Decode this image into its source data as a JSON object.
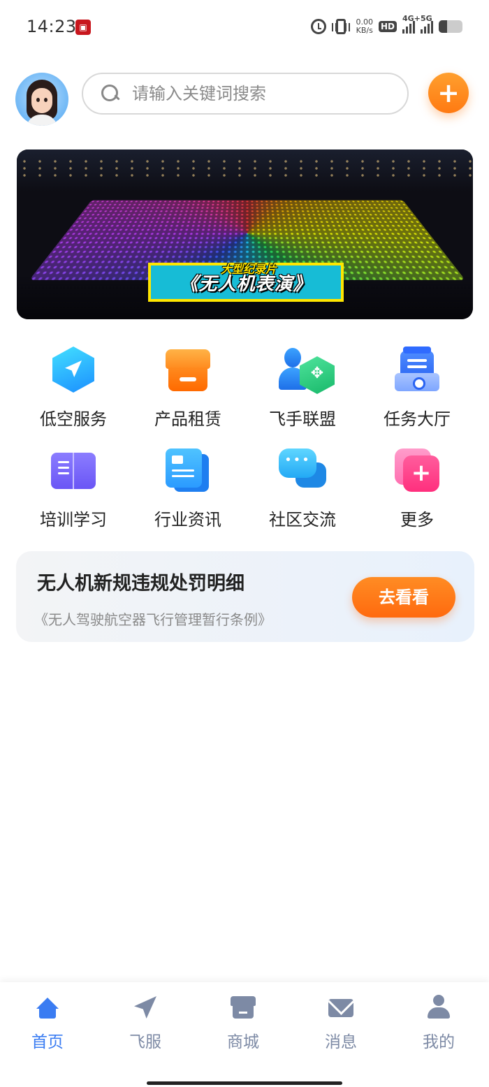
{
  "status_bar": {
    "time": "14:23",
    "netspeed_value": "0.00",
    "netspeed_unit": "KB/s",
    "hd_label": "HD",
    "signal1_label": "4G+",
    "signal2_label": "5G",
    "battery_level_percent": 35
  },
  "header": {
    "search_placeholder": "请输入关键词搜索",
    "add_label": "+"
  },
  "banner": {
    "caption_top": "大型纪录片",
    "caption_main": "《无人机表演》"
  },
  "grid": {
    "items": [
      {
        "label": "低空服务",
        "icon": "paper-plane-hex-icon"
      },
      {
        "label": "产品租赁",
        "icon": "shop-icon"
      },
      {
        "label": "飞手联盟",
        "icon": "pilot-drone-icon"
      },
      {
        "label": "任务大厅",
        "icon": "clipboard-icon"
      },
      {
        "label": "培训学习",
        "icon": "book-icon"
      },
      {
        "label": "行业资讯",
        "icon": "news-doc-icon"
      },
      {
        "label": "社区交流",
        "icon": "chat-bubbles-icon"
      },
      {
        "label": "更多",
        "icon": "plus-squares-icon"
      }
    ]
  },
  "notice": {
    "title": "无人机新规违规处罚明细",
    "subtitle": "《无人驾驶航空器飞行管理暂行条例》",
    "button_label": "去看看"
  },
  "tab_bar": {
    "active": "首页",
    "tabs": [
      {
        "label": "首页",
        "icon": "home-icon"
      },
      {
        "label": "飞服",
        "icon": "paper-plane-icon"
      },
      {
        "label": "商城",
        "icon": "store-icon"
      },
      {
        "label": "消息",
        "icon": "mail-icon"
      },
      {
        "label": "我的",
        "icon": "user-icon"
      }
    ]
  },
  "colors": {
    "accent_orange": "#ff7a12",
    "tab_active": "#3a7cf2",
    "tab_inactive": "#7d8aa5"
  }
}
